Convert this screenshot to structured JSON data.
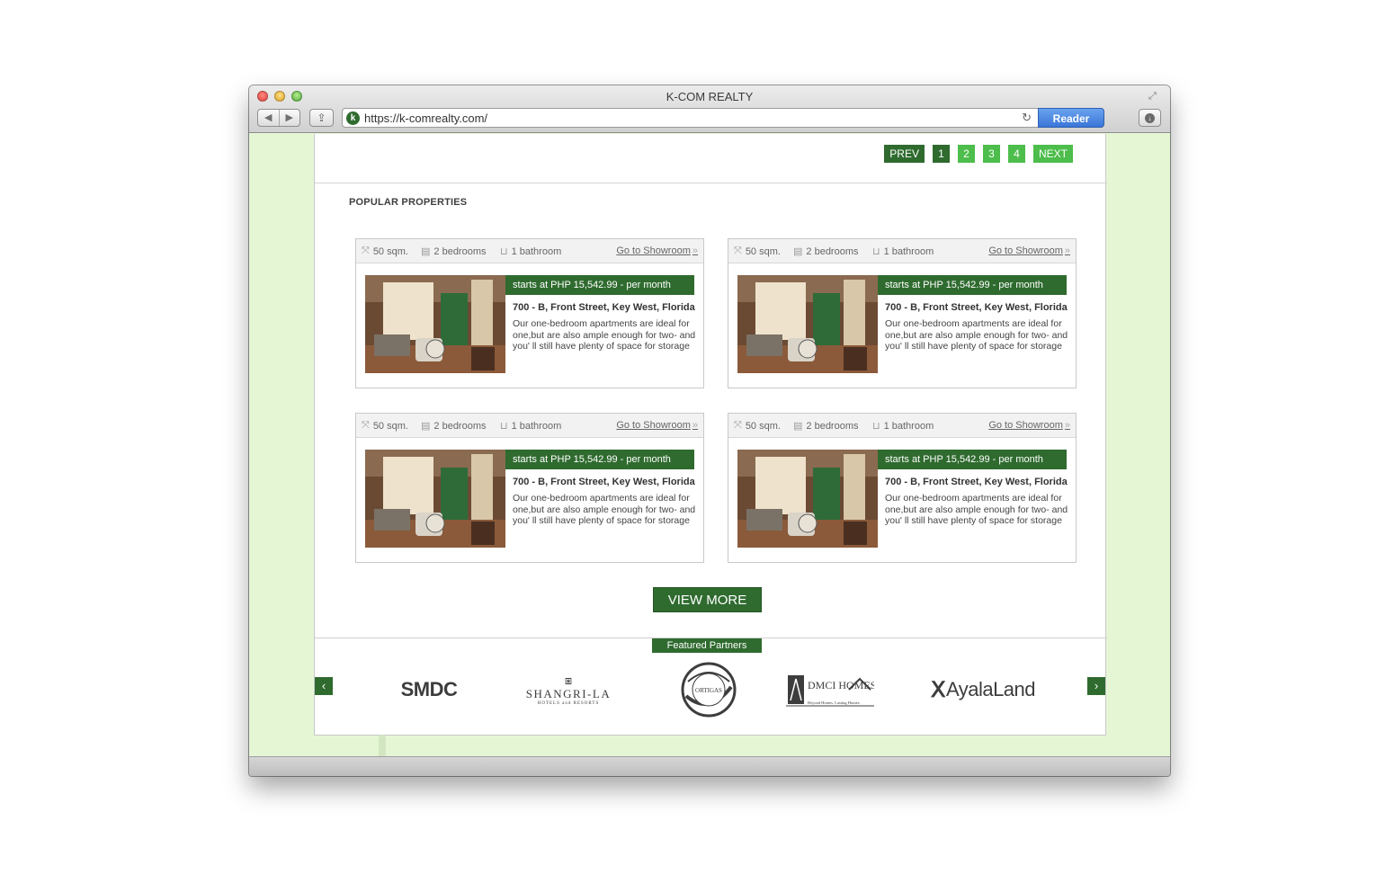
{
  "window": {
    "title": "K-COM REALTY"
  },
  "toolbar": {
    "url": "https://k-comrealty.com/",
    "reader_label": "Reader",
    "favicon_letter": "k"
  },
  "pagination": {
    "prev": "PREV",
    "pages": [
      "1",
      "2",
      "3",
      "4"
    ],
    "current": "1",
    "next": "NEXT"
  },
  "section": {
    "title": "POPULAR PROPERTIES"
  },
  "properties": [
    {
      "area": "50 sqm.",
      "bedrooms": "2 bedrooms",
      "bathrooms": "1 bathroom",
      "showroom": "Go to Showroom",
      "price": "starts at PHP 15,542.99 - per month",
      "address": "700 - B, Front Street, Key West, Florida",
      "description": "Our one-bedroom apartments are ideal for one,but are also ample enough for two- and you' ll still have plenty of space for storage"
    },
    {
      "area": "50 sqm.",
      "bedrooms": "2 bedrooms",
      "bathrooms": "1 bathroom",
      "showroom": "Go to Showroom",
      "price": "starts at PHP 15,542.99 - per month",
      "address": "700 - B, Front Street, Key West, Florida",
      "description": "Our one-bedroom apartments are ideal for one,but are also ample enough for two- and you' ll still have plenty of space for storage"
    },
    {
      "area": "50 sqm.",
      "bedrooms": "2 bedrooms",
      "bathrooms": "1 bathroom",
      "showroom": "Go to Showroom",
      "price": "starts at PHP 15,542.99 - per month",
      "address": "700 - B, Front Street, Key West, Florida",
      "description": "Our one-bedroom apartments are ideal for one,but are also ample enough for two- and you' ll still have plenty of space for storage"
    },
    {
      "area": "50 sqm.",
      "bedrooms": "2 bedrooms",
      "bathrooms": "1 bathroom",
      "showroom": "Go to Showroom",
      "price": "starts at PHP 15,542.99 - per month",
      "address": "700 - B, Front Street, Key West, Florida",
      "description": "Our one-bedroom apartments are ideal for one,but are also ample enough for two- and you' ll still have plenty of space for storage"
    }
  ],
  "view_more_label": "VIEW MORE",
  "partners": {
    "label": "Featured Partners",
    "logos": {
      "smdc": "SMDC",
      "shangri": "SHANGRI-LA",
      "shangri_sub": "HOTELS and RESORTS",
      "ortigas": "ORTIGAS",
      "dmci": "DMCI HOMES",
      "dmci_sub": "Beyond Homes. Lasting Homes.",
      "ayala": "AyalaLand"
    }
  },
  "colors": {
    "brand_dark": "#2f6b2f",
    "brand_light": "#4dbd4b",
    "page_bg": "#e5f6d5",
    "reader_blue": "#3a76d8"
  }
}
